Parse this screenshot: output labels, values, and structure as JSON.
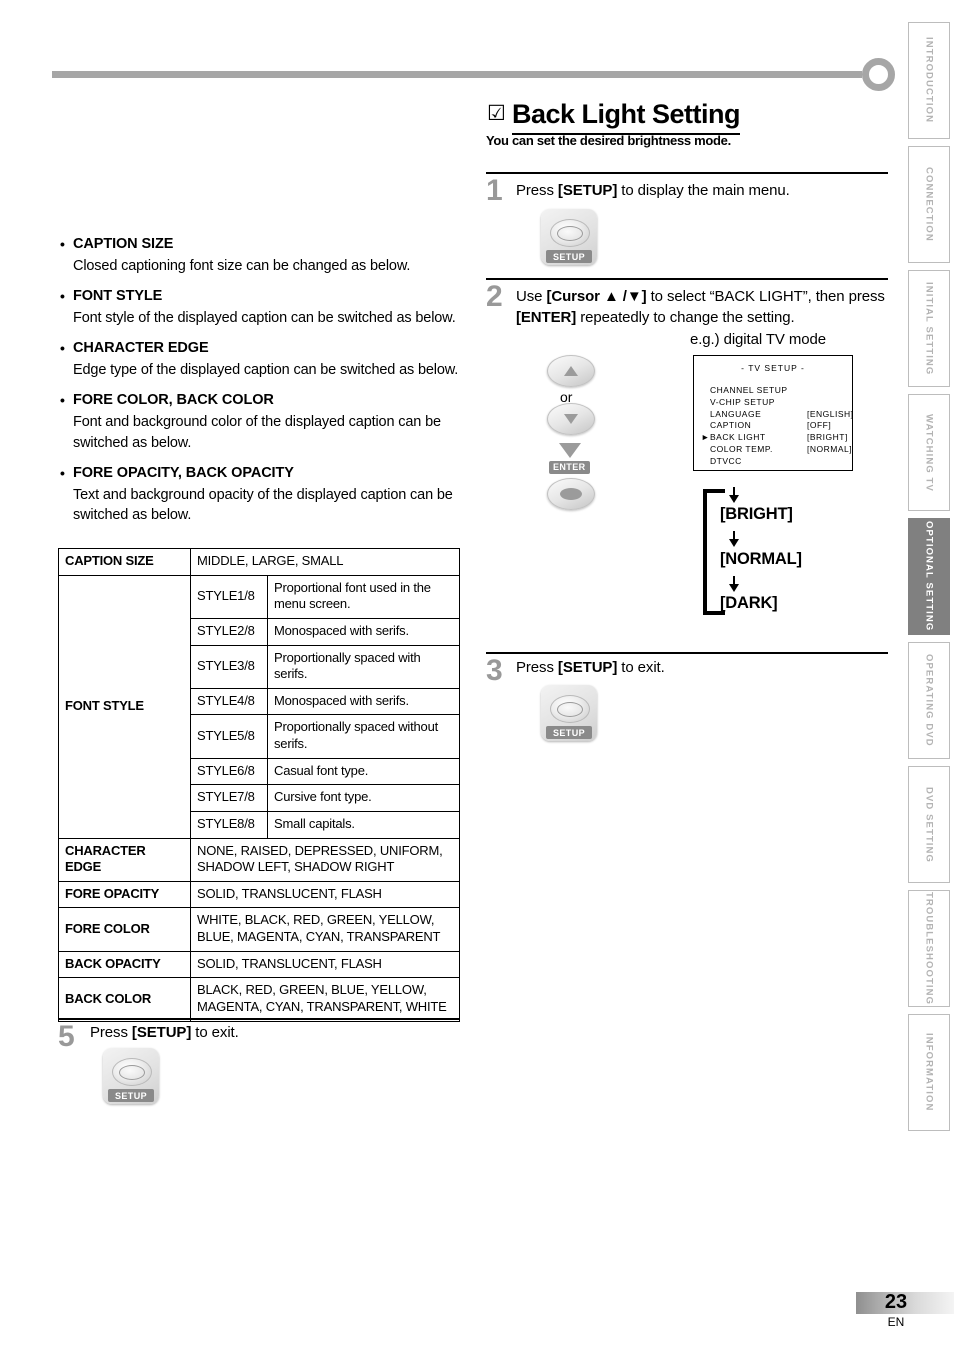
{
  "section": {
    "title": "Back Light Setting",
    "checkbox_glyph": "☑",
    "subtitle": "You can set the desired brightness mode."
  },
  "left_column": {
    "bullets": [
      {
        "head": "CAPTION SIZE",
        "body": "Closed captioning font size can be changed as below."
      },
      {
        "head": "FONT STYLE",
        "body": "Font style of the displayed caption can be switched as below."
      },
      {
        "head": "CHARACTER EDGE",
        "body": "Edge type of the displayed caption can be switched as below."
      },
      {
        "head": "FORE COLOR, BACK COLOR",
        "body": "Font and background color of the displayed caption can be switched as below."
      },
      {
        "head": "FORE OPACITY, BACK OPACITY",
        "body": "Text and background opacity of the displayed caption can be switched as below."
      }
    ],
    "table": {
      "caption_size_label": "CAPTION SIZE",
      "caption_size_values": "MIDDLE, LARGE, SMALL",
      "font_style_label": "FONT STYLE",
      "font_styles": [
        {
          "name": "STYLE1/8",
          "desc": "Proportional font used in the menu screen."
        },
        {
          "name": "STYLE2/8",
          "desc": "Monospaced with serifs."
        },
        {
          "name": "STYLE3/8",
          "desc": "Proportionally spaced with serifs."
        },
        {
          "name": "STYLE4/8",
          "desc": "Monospaced with serifs."
        },
        {
          "name": "STYLE5/8",
          "desc": "Proportionally spaced without serifs."
        },
        {
          "name": "STYLE6/8",
          "desc": "Casual font type."
        },
        {
          "name": "STYLE7/8",
          "desc": "Cursive font type."
        },
        {
          "name": "STYLE8/8",
          "desc": "Small capitals."
        }
      ],
      "rows": [
        {
          "label": "CHARACTER EDGE",
          "values": "NONE, RAISED, DEPRESSED, UNIFORM, SHADOW LEFT, SHADOW RIGHT"
        },
        {
          "label": "FORE OPACITY",
          "values": "SOLID, TRANSLUCENT, FLASH"
        },
        {
          "label": "FORE COLOR",
          "values": "WHITE, BLACK, RED, GREEN, YELLOW, BLUE, MAGENTA, CYAN, TRANSPARENT"
        },
        {
          "label": "BACK OPACITY",
          "values": "SOLID, TRANSLUCENT, FLASH"
        },
        {
          "label": "BACK COLOR",
          "values": "BLACK, RED, GREEN, BLUE, YELLOW, MAGENTA, CYAN, TRANSPARENT, WHITE"
        }
      ]
    },
    "step5": {
      "number": "5",
      "text_before": "Press ",
      "key": "[SETUP]",
      "text_after": " to exit.",
      "setup_key_label": "SETUP"
    }
  },
  "right_column": {
    "step1": {
      "number": "1",
      "text_before": "Press ",
      "key": "[SETUP]",
      "text_after": " to display the main menu.",
      "setup_key_label": "SETUP"
    },
    "step2": {
      "number": "2",
      "line1_a": "Use ",
      "line1_key": "[Cursor ▲ /▼]",
      "line1_b": " to select “BACK LIGHT”, then press",
      "line2_key": "[ENTER]",
      "line2_b": " repeatedly to change the setting.",
      "example_label": "e.g.) digital TV mode",
      "or_label": "or",
      "enter_label": "ENTER"
    },
    "step3": {
      "number": "3",
      "text_before": "Press ",
      "key": "[SETUP]",
      "text_after": " to exit.",
      "setup_key_label": "SETUP"
    },
    "osd": {
      "title": "-  TV SETUP  -",
      "rows": [
        {
          "pointer": "",
          "name": "CHANNEL SETUP",
          "value": ""
        },
        {
          "pointer": "",
          "name": "V-CHIP  SETUP",
          "value": ""
        },
        {
          "pointer": "",
          "name": "LANGUAGE",
          "value": "[ENGLISH]"
        },
        {
          "pointer": "",
          "name": "CAPTION",
          "value": "[OFF]"
        },
        {
          "pointer": "►",
          "name": "BACK  LIGHT",
          "value": "[BRIGHT]"
        },
        {
          "pointer": "",
          "name": "COLOR  TEMP.",
          "value": "[NORMAL]"
        },
        {
          "pointer": "",
          "name": "DTVCC",
          "value": ""
        }
      ]
    },
    "loop_options": [
      "[BRIGHT]",
      "[NORMAL]",
      "[DARK]"
    ]
  },
  "sidebar": {
    "tabs": [
      {
        "label": "INTRODUCTION",
        "active": false
      },
      {
        "label": "CONNECTION",
        "active": false
      },
      {
        "label": "INITIAL  SETTING",
        "active": false
      },
      {
        "label": "WATCHING  TV",
        "active": false
      },
      {
        "label": "OPTIONAL  SETTING",
        "active": true
      },
      {
        "label": "OPERATING  DVD",
        "active": false
      },
      {
        "label": "DVD  SETTING",
        "active": false
      },
      {
        "label": "TROUBLESHOOTING",
        "active": false
      },
      {
        "label": "INFORMATION",
        "active": false
      }
    ]
  },
  "footer": {
    "page_number": "23",
    "language": "EN"
  },
  "colors": {
    "rule": "#a6a6a6",
    "step_number": "#999999",
    "active_tab": "#808080",
    "tab_text": "#b3b3b3"
  }
}
